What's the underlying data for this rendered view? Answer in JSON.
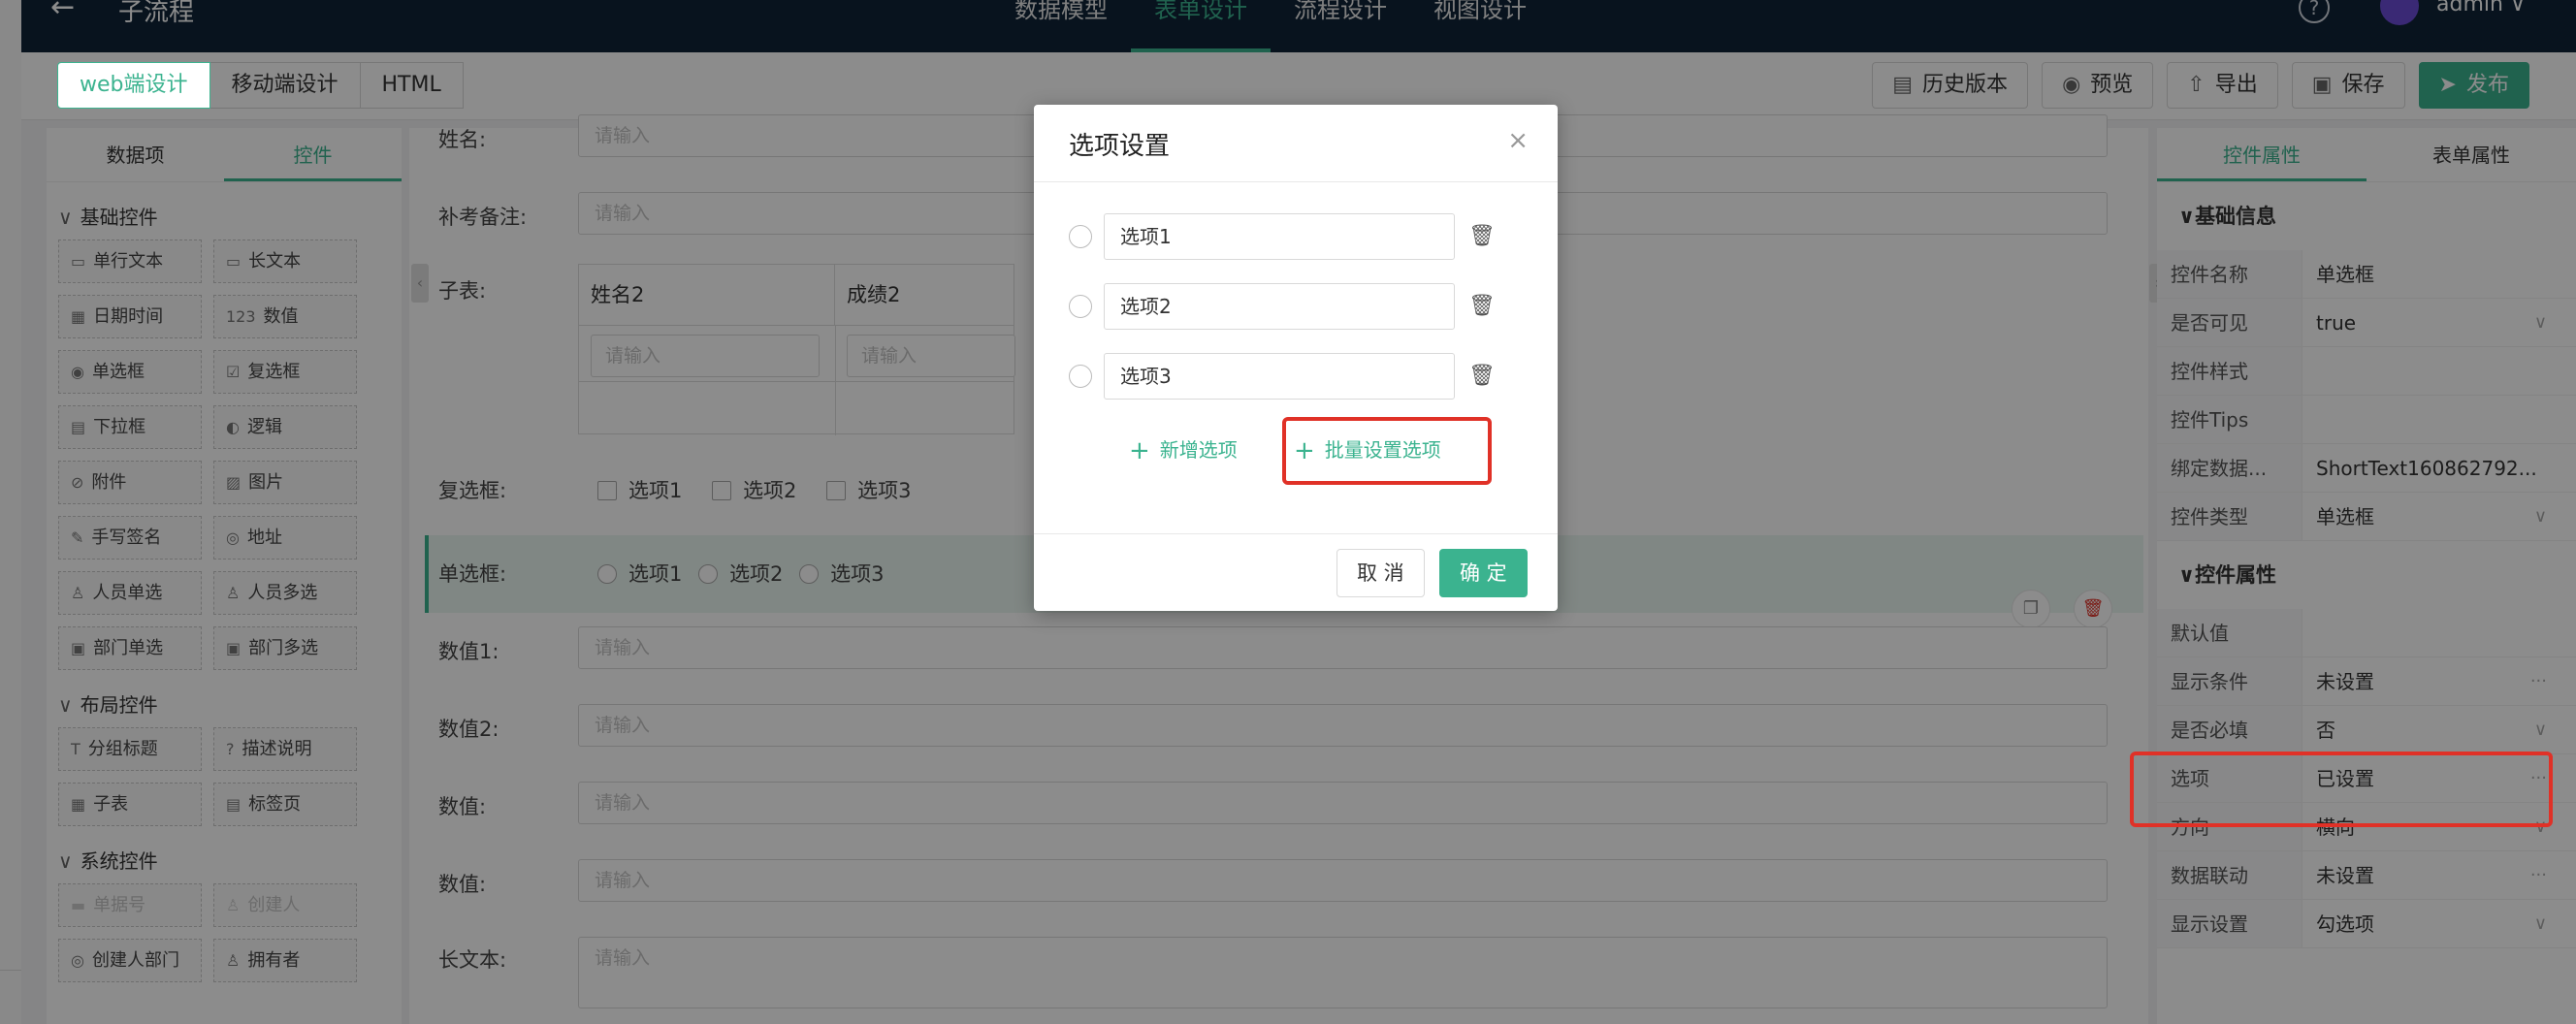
{
  "topbar": {
    "back_icon": "←",
    "title": "子流程",
    "nav": [
      "数据模型",
      "表单设计",
      "流程设计",
      "视图设计"
    ],
    "active_nav": 1,
    "help_icon": "?",
    "user": "admin",
    "user_chevron": "∨"
  },
  "toolbar": {
    "modes": [
      "web端设计",
      "移动端设计",
      "HTML"
    ],
    "actions": [
      {
        "icon": "▤",
        "label": "历史版本"
      },
      {
        "icon": "◉",
        "label": "预览"
      },
      {
        "icon": "⇧",
        "label": "导出"
      },
      {
        "icon": "▣",
        "label": "保存"
      },
      {
        "icon": "➤",
        "label": "发布"
      }
    ]
  },
  "left_panel": {
    "tabs": [
      "数据项",
      "控件"
    ],
    "sections": [
      {
        "title": "基础控件",
        "items": [
          {
            "icon": "▭",
            "label": "单行文本"
          },
          {
            "icon": "▭",
            "label": "长文本"
          },
          {
            "icon": "▦",
            "label": "日期时间"
          },
          {
            "icon": "123",
            "label": "数值"
          },
          {
            "icon": "◉",
            "label": "单选框"
          },
          {
            "icon": "☑",
            "label": "复选框"
          },
          {
            "icon": "▤",
            "label": "下拉框"
          },
          {
            "icon": "◐",
            "label": "逻辑"
          },
          {
            "icon": "⊘",
            "label": "附件"
          },
          {
            "icon": "▨",
            "label": "图片"
          },
          {
            "icon": "✎",
            "label": "手写签名"
          },
          {
            "icon": "◎",
            "label": "地址"
          },
          {
            "icon": "♙",
            "label": "人员单选"
          },
          {
            "icon": "♙",
            "label": "人员多选"
          },
          {
            "icon": "▣",
            "label": "部门单选"
          },
          {
            "icon": "▣",
            "label": "部门多选"
          }
        ]
      },
      {
        "title": "布局控件",
        "items": [
          {
            "icon": "T",
            "label": "分组标题"
          },
          {
            "icon": "?",
            "label": "描述说明"
          },
          {
            "icon": "▦",
            "label": "子表"
          },
          {
            "icon": "▤",
            "label": "标签页"
          }
        ]
      },
      {
        "title": "系统控件",
        "items": [
          {
            "icon": "▬",
            "label": "单据号"
          },
          {
            "icon": "♙",
            "label": "创建人"
          },
          {
            "icon": "◎",
            "label": "创建人部门"
          },
          {
            "icon": "♙",
            "label": "拥有者"
          }
        ]
      }
    ]
  },
  "canvas": {
    "name_label": "姓名:",
    "placeholder": "请输入",
    "makeup_label": "补考备注:",
    "subtable_label": "子表:",
    "subtable_cols": [
      "姓名2",
      "成绩2"
    ],
    "checkbox_label": "复选框:",
    "radio_label": "单选框:",
    "options": [
      "选项1",
      "选项2",
      "选项3"
    ],
    "num1_label": "数值1:",
    "num2_label": "数值2:",
    "num3_label": "数值:",
    "num4_label": "数值:",
    "longtext_label": "长文本:",
    "copy_icon": "❐",
    "delete_icon": "🗑"
  },
  "right_panel": {
    "tabs": [
      "控件属性",
      "表单属性"
    ],
    "group1": "基础信息",
    "group2": "控件属性",
    "basic": [
      {
        "k": "控件名称",
        "v": "单选框",
        "s": ""
      },
      {
        "k": "是否可见",
        "v": "true",
        "s": "∨"
      },
      {
        "k": "控件样式",
        "v": "",
        "s": ""
      },
      {
        "k": "控件Tips",
        "v": "",
        "s": ""
      },
      {
        "k": "绑定数据...",
        "v": "ShortText160862792...",
        "s": ""
      },
      {
        "k": "控件类型",
        "v": "单选框",
        "s": "∨"
      }
    ],
    "props": [
      {
        "k": "默认值",
        "v": "",
        "s": ""
      },
      {
        "k": "显示条件",
        "v": "未设置",
        "s": "···"
      },
      {
        "k": "是否必填",
        "v": "否",
        "s": "∨"
      },
      {
        "k": "选项",
        "v": "已设置",
        "s": "···"
      },
      {
        "k": "方向",
        "v": "横向",
        "s": "∨"
      },
      {
        "k": "数据联动",
        "v": "未设置",
        "s": "···"
      },
      {
        "k": "显示设置",
        "v": "勾选项",
        "s": "∨"
      }
    ]
  },
  "modal": {
    "title": "选项设置",
    "close_icon": "×",
    "options": [
      "选项1",
      "选项2",
      "选项3"
    ],
    "trash_icon": "🗑",
    "add_option": "新增选项",
    "batch_option": "批量设置选项",
    "plus_icon": "+",
    "cancel": "取 消",
    "ok": "确 定"
  },
  "colors": {
    "accent": "#3bb38f",
    "topbar": "#0f2438",
    "highlight": "#e03127"
  }
}
